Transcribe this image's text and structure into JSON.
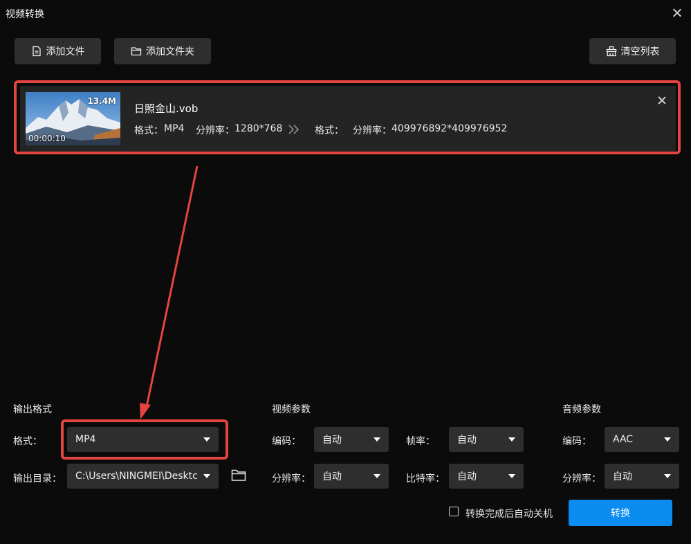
{
  "window": {
    "title": "视频转换"
  },
  "toolbar": {
    "add_file": "添加文件",
    "add_folder": "添加文件夹",
    "clear_list": "清空列表"
  },
  "file": {
    "name": "日照金山.vob",
    "size": "13.4M",
    "duration": "00:00:10",
    "src_format_label": "格式：",
    "src_format": "MP4",
    "src_res_label": "分辨率：",
    "src_res": "1280*768",
    "dst_format_label": "格式：",
    "dst_format": "",
    "dst_res_label": "分辨率：",
    "dst_res": "409976892*409976952"
  },
  "output": {
    "section": "输出格式",
    "format_label": "格式：",
    "format_value": "MP4",
    "dir_label": "输出目录：",
    "dir_value": "C:\\Users\\NINGMEI\\Desktc"
  },
  "video": {
    "section": "视频参数",
    "codec_label": "编码：",
    "codec_value": "自动",
    "fps_label": "帧率：",
    "fps_value": "自动",
    "res_label": "分辨率：",
    "res_value": "自动",
    "bitrate_label": "比特率：",
    "bitrate_value": "自动"
  },
  "audio": {
    "section": "音频参数",
    "codec_label": "编码：",
    "codec_value": "AAC",
    "res_label": "分辨率：",
    "res_value": "自动"
  },
  "footer": {
    "shutdown_label": "转换完成后自动关机",
    "convert": "转换"
  },
  "colors": {
    "accent": "#0a8cf0",
    "highlight": "#e5443f",
    "background": "#0b0b0b",
    "control": "#2e2e2e"
  }
}
